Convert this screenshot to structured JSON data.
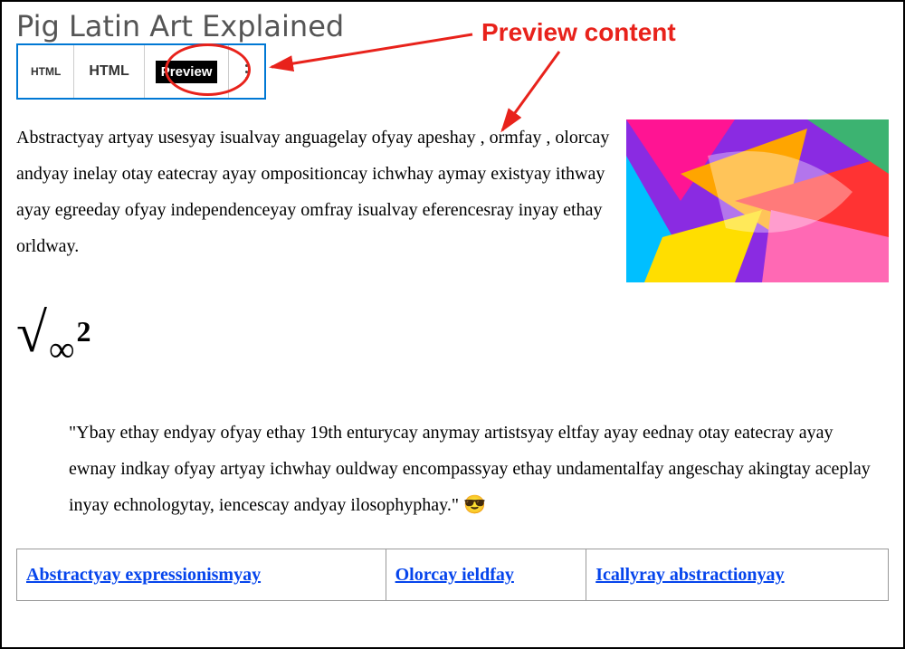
{
  "title": "Pig Latin Art Explained",
  "toolbar": {
    "html_icon_label": "HTML",
    "html_label": "HTML",
    "preview_label": "Preview"
  },
  "annotation": {
    "label": "Preview content"
  },
  "content": {
    "lead": "Abstractyay artyay usesyay isualvay anguagelay ofyay apeshay , ormfay , olorcay andyay inelay otay eatecray ayay ompositioncay ichwhay aymay existyay ithway ayay egreeday ofyay independenceyay omfray isualvay eferencesray inyay ethay orldway.",
    "formula": {
      "radical": "√",
      "infinity": "∞",
      "exponent": "2"
    },
    "quote": "\"Ybay ethay endyay ofyay ethay 19th enturycay anymay artistsyay eltfay ayay eednay otay eatecray ayay ewnay indkay ofyay artyay ichwhay ouldway encompassyay ethay undamentalfay angeschay akingtay aceplay inyay echnologytay, iencescay andyay ilosophyphay.\" 😎",
    "table": {
      "row1": [
        "Abstractyay expressionismyay",
        "Olorcay ieldfay",
        "Icallyray abstractionyay"
      ]
    }
  },
  "icons": {
    "more": "more-vertical-icon",
    "paint_thumb": "abstract-paint-thumbnail"
  }
}
